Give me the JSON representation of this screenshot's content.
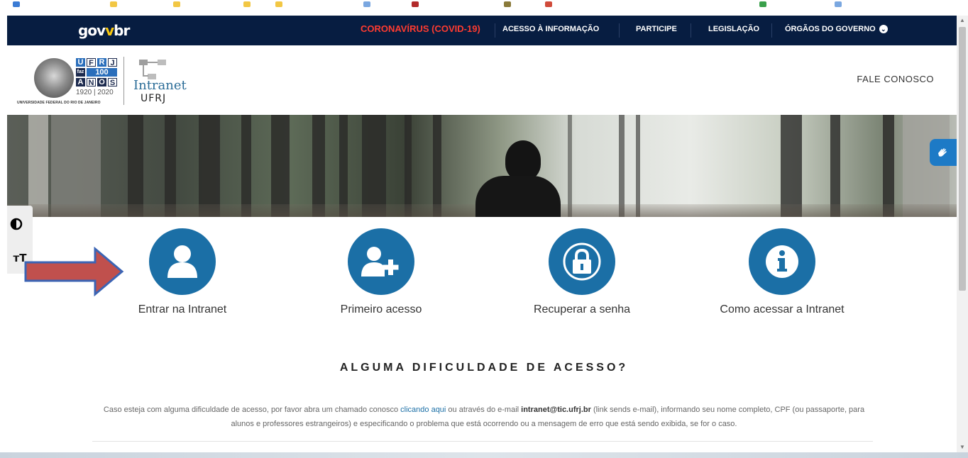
{
  "govbar": {
    "logo_gov": "gov",
    "logo_br": "br",
    "links": [
      {
        "label": "CORONAVÍRUS (COVID-19)"
      },
      {
        "label": "ACESSO À INFORMAÇÃO"
      },
      {
        "label": "PARTICIPE"
      },
      {
        "label": "LEGISLAÇÃO"
      },
      {
        "label": "ÓRGÃOS DO GOVERNO"
      }
    ]
  },
  "header": {
    "ufrj_letters": [
      "U",
      "F",
      "R",
      "J"
    ],
    "faz": "faz",
    "hundred": "100",
    "anos_letters": [
      "A",
      "N",
      "O",
      "S"
    ],
    "years": "1920 | 2020",
    "university_name": "UNIVERSIDADE FEDERAL DO RIO DE JANEIRO",
    "intranet_word": "Intranet",
    "intranet_ufrj": "UFRJ",
    "contact_link": "FALE CONOSCO"
  },
  "a11y": {
    "font_label": "тT"
  },
  "actions": [
    {
      "label": "Entrar na Intranet",
      "icon": "user-icon"
    },
    {
      "label": "Primeiro acesso",
      "icon": "user-plus-icon"
    },
    {
      "label": "Recuperar a senha",
      "icon": "lock-icon"
    },
    {
      "label": "Como acessar a Intranet",
      "icon": "info-icon"
    }
  ],
  "help": {
    "title": "ALGUMA DIFICULDADE DE ACESSO?",
    "text_before_link": "Caso esteja com alguma dificuldade de acesso, por favor abra um chamado conosco ",
    "link": "clicando aqui",
    "text_before_email": " ou através do e-mail ",
    "email": "intranet@tic.ufrj.br",
    "text_after_email": " (link sends e-mail), informando seu nome completo, CPF (ou passaporte, para alunos e professores estrangeiros) e especificando o problema que está ocorrendo ou a mensagem de erro que está sendo exibida, se for o caso."
  },
  "colors": {
    "govbar_bg": "#071d41",
    "covid_red": "#ff3b30",
    "primary_blue": "#1b6fa6",
    "arrow_red": "#c0504d",
    "arrow_outline": "#3b64b4"
  }
}
